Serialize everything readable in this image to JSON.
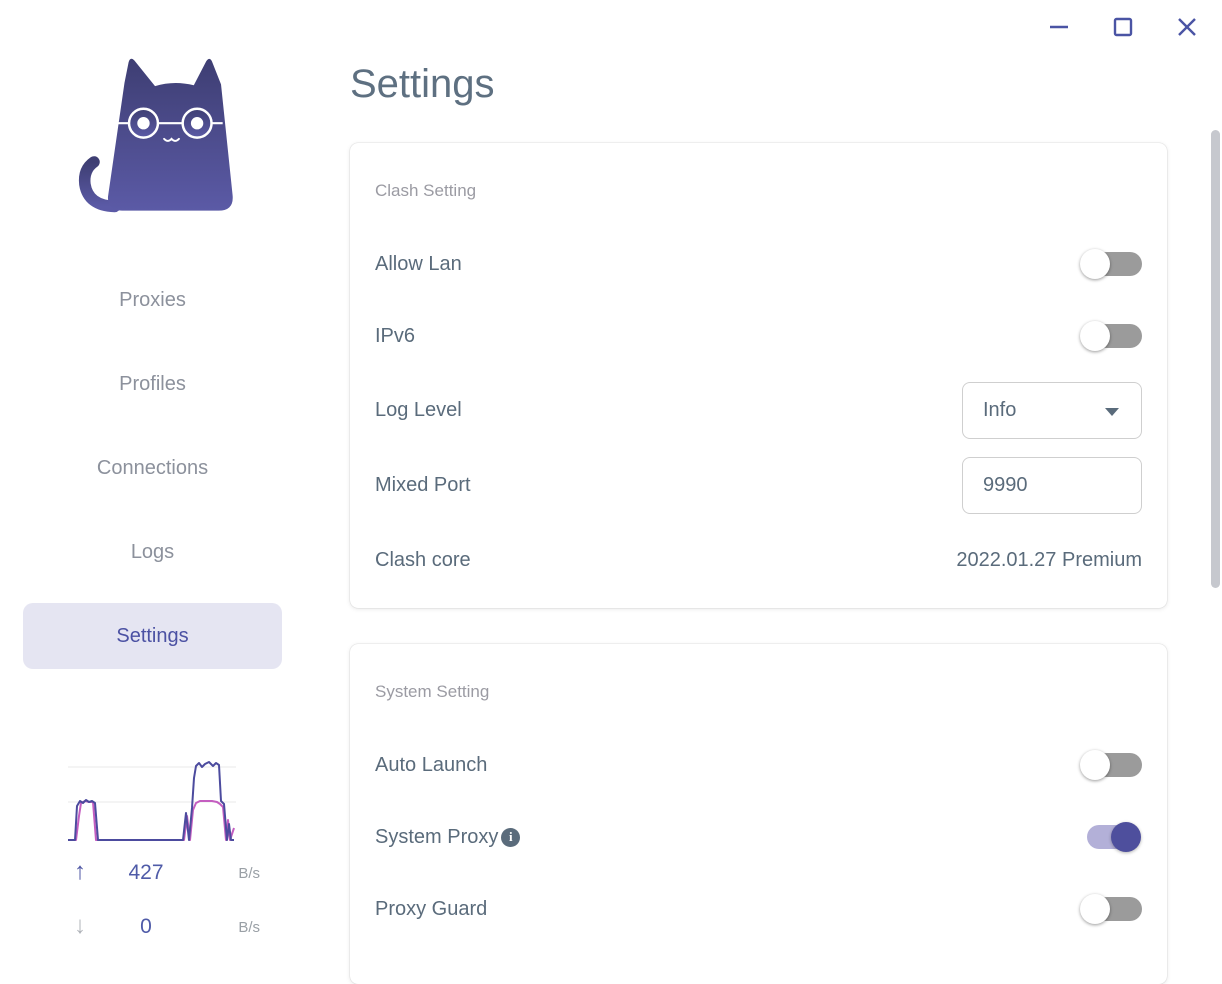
{
  "window": {
    "icons": {
      "minimize": "—",
      "maximize": "□",
      "close": "✕"
    }
  },
  "sidebar": {
    "items": [
      {
        "label": "Proxies",
        "active": "off"
      },
      {
        "label": "Profiles",
        "active": "off"
      },
      {
        "label": "Connections",
        "active": "off"
      },
      {
        "label": "Logs",
        "active": "off"
      },
      {
        "label": "Settings",
        "active": "on"
      }
    ],
    "traffic": {
      "up": {
        "icon": "↑",
        "value": "427",
        "unit": "B/s"
      },
      "down": {
        "icon": "↓",
        "value": "0",
        "unit": "B/s"
      },
      "graph": {
        "series": [
          {
            "name": "upload",
            "color": "#4c4b9e"
          },
          {
            "name": "download",
            "color": "#c45ec0"
          }
        ]
      }
    }
  },
  "main": {
    "title": "Settings",
    "cards": [
      {
        "header": "Clash Setting",
        "rows": [
          {
            "label": "Allow Lan",
            "control": "toggle",
            "state": "off"
          },
          {
            "label": "IPv6",
            "control": "toggle",
            "state": "off"
          },
          {
            "label": "Log Level",
            "control": "select",
            "value": "Info"
          },
          {
            "label": "Mixed Port",
            "control": "input",
            "value": "9990"
          },
          {
            "label": "Clash core",
            "control": "text",
            "value": "2022.01.27 Premium"
          }
        ]
      },
      {
        "header": "System Setting",
        "rows": [
          {
            "label": "Auto Launch",
            "control": "toggle",
            "state": "off"
          },
          {
            "label": "System Proxy",
            "control": "toggle",
            "state": "on",
            "info_icon": "i"
          },
          {
            "label": "Proxy Guard",
            "control": "toggle",
            "state": "off"
          }
        ]
      }
    ]
  },
  "colors": {
    "accent": "#4e4f9d",
    "nav_active_bg": "#e5e5f2",
    "nav_active_text": "#4b51a3",
    "label_text": "#5a6b7b",
    "muted_text": "#9b9ba3",
    "toggle_off_track": "#9b9b9b",
    "toggle_on_track": "#b3b0d8",
    "graph_upload": "#4c4b9e",
    "graph_download": "#c45ec0"
  }
}
